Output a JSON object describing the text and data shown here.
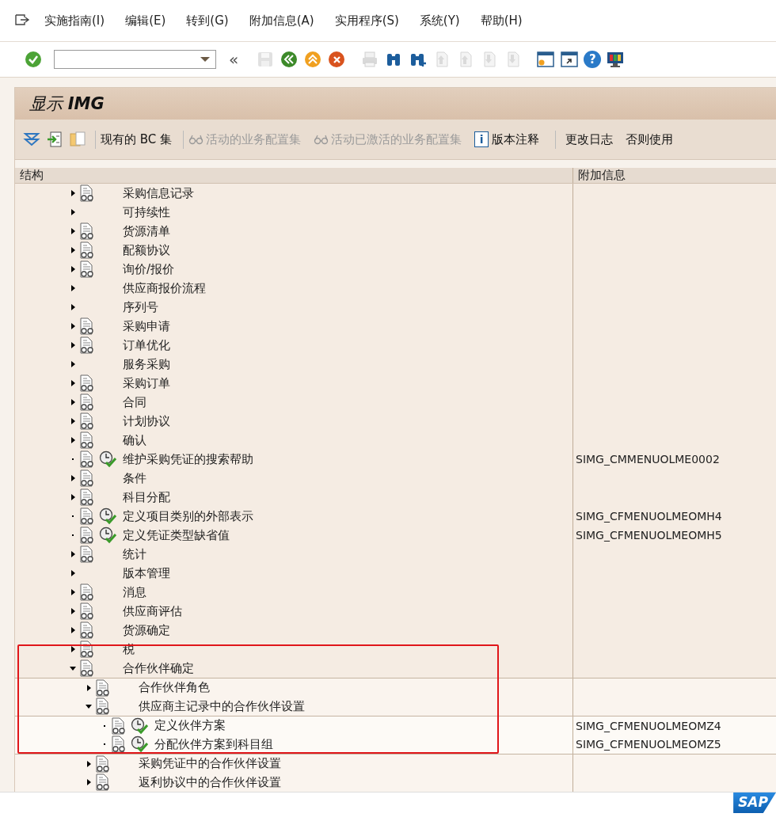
{
  "menu_bar": [
    "实施指南(I)",
    "编辑(E)",
    "转到(G)",
    "附加信息(A)",
    "实用程序(S)",
    "系统(Y)",
    "帮助(H)"
  ],
  "toolbar": [
    {
      "kind": "enter",
      "disabled": false
    },
    {
      "kind": "command_field"
    },
    {
      "kind": "collapse",
      "text": "«"
    },
    {
      "kind": "save",
      "disabled": true
    },
    {
      "kind": "back",
      "disabled": false
    },
    {
      "kind": "exit",
      "disabled": false
    },
    {
      "kind": "cancel",
      "disabled": false
    },
    {
      "kind": "print",
      "disabled": true
    },
    {
      "kind": "find",
      "disabled": false
    },
    {
      "kind": "find_next",
      "disabled": false
    },
    {
      "kind": "first_page",
      "disabled": true
    },
    {
      "kind": "prev_page",
      "disabled": true
    },
    {
      "kind": "next_page",
      "disabled": true
    },
    {
      "kind": "last_page",
      "disabled": true
    },
    {
      "kind": "new_session",
      "disabled": false
    },
    {
      "kind": "shortcut",
      "disabled": false
    },
    {
      "kind": "help",
      "text": "?",
      "disabled": false
    },
    {
      "kind": "layout",
      "disabled": false
    }
  ],
  "title": "显示 **IMG**",
  "app_toolbar": [
    {
      "kind": "expand_icon"
    },
    {
      "kind": "docs_icon"
    },
    {
      "kind": "copy_icon"
    },
    {
      "kind": "text",
      "label": "现有的 BC 集",
      "disabled": false
    },
    {
      "kind": "glasses",
      "label": "活动的业务配置集",
      "disabled": true
    },
    {
      "kind": "glasses",
      "label": "活动已激活的业务配置集",
      "disabled": true
    },
    {
      "kind": "info",
      "icon_text": "i",
      "label": "版本注释",
      "disabled": false
    },
    {
      "kind": "text",
      "label": "更改日志",
      "disabled": false
    },
    {
      "kind": "text",
      "label": "否则使用",
      "disabled": false
    }
  ],
  "columns": [
    "结构",
    "附加信息"
  ],
  "tree": [
    {
      "label": "采购信息记录",
      "kind": "folder",
      "expanded": false,
      "doc": true
    },
    {
      "label": "可持续性",
      "kind": "folder",
      "expanded": false,
      "doc": false
    },
    {
      "label": "货源清单",
      "kind": "folder",
      "expanded": false,
      "doc": true
    },
    {
      "label": "配额协议",
      "kind": "folder",
      "expanded": false,
      "doc": true
    },
    {
      "label": "询价/报价",
      "kind": "folder",
      "expanded": false,
      "doc": true
    },
    {
      "label": "供应商报价流程",
      "kind": "folder",
      "expanded": false,
      "doc": false
    },
    {
      "label": "序列号",
      "kind": "folder",
      "expanded": false,
      "doc": false
    },
    {
      "label": "采购申请",
      "kind": "folder",
      "expanded": false,
      "doc": true
    },
    {
      "label": "订单优化",
      "kind": "folder",
      "expanded": false,
      "doc": true
    },
    {
      "label": "服务采购",
      "kind": "folder",
      "expanded": false,
      "doc": false
    },
    {
      "label": "采购订单",
      "kind": "folder",
      "expanded": false,
      "doc": true
    },
    {
      "label": "合同",
      "kind": "folder",
      "expanded": false,
      "doc": true
    },
    {
      "label": "计划协议",
      "kind": "folder",
      "expanded": false,
      "doc": true
    },
    {
      "label": "确认",
      "kind": "folder",
      "expanded": false,
      "doc": true
    },
    {
      "label": "维护采购凭证的搜索帮助",
      "kind": "activity",
      "doc": true,
      "info": "SIMG_CMMENUOLME0002"
    },
    {
      "label": "条件",
      "kind": "folder",
      "expanded": false,
      "doc": true
    },
    {
      "label": "科目分配",
      "kind": "folder",
      "expanded": false,
      "doc": true
    },
    {
      "label": "定义项目类别的外部表示",
      "kind": "activity",
      "doc": true,
      "info": "SIMG_CFMENUOLMEOMH4"
    },
    {
      "label": "定义凭证类型缺省值",
      "kind": "activity",
      "doc": true,
      "info": "SIMG_CFMENUOLMEOMH5"
    },
    {
      "label": "统计",
      "kind": "folder",
      "expanded": false,
      "doc": true
    },
    {
      "label": "版本管理",
      "kind": "folder",
      "expanded": false,
      "doc": false
    },
    {
      "label": "消息",
      "kind": "folder",
      "expanded": false,
      "doc": true
    },
    {
      "label": "供应商评估",
      "kind": "folder",
      "expanded": false,
      "doc": true
    },
    {
      "label": "货源确定",
      "kind": "folder",
      "expanded": false,
      "doc": true
    },
    {
      "label": "税",
      "kind": "folder",
      "expanded": false,
      "doc": true
    },
    {
      "label": "合作伙伴确定",
      "kind": "folder",
      "expanded": true,
      "doc": true,
      "children": [
        {
          "label": "合作伙伴角色",
          "kind": "folder",
          "expanded": false,
          "doc": true
        },
        {
          "label": "供应商主记录中的合作伙伴设置",
          "kind": "folder",
          "expanded": true,
          "doc": true,
          "children": [
            {
              "label": "定义伙伴方案",
              "kind": "activity",
              "doc": true,
              "info": "SIMG_CFMENUOLMEOMZ4"
            },
            {
              "label": "分配伙伴方案到科目组",
              "kind": "activity",
              "doc": true,
              "info": "SIMG_CFMENUOLMEOMZ5"
            }
          ]
        },
        {
          "label": "采购凭证中的合作伙伴设置",
          "kind": "folder",
          "expanded": false,
          "doc": true
        },
        {
          "label": "返利协议中的合作伙伴设置",
          "kind": "folder",
          "expanded": false,
          "doc": true
        }
      ]
    }
  ],
  "status_bar": {
    "logo": "SAP"
  }
}
